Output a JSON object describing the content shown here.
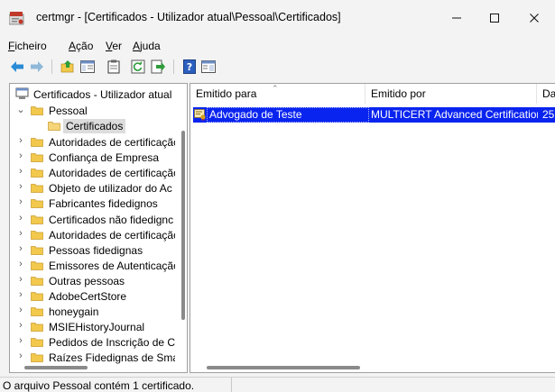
{
  "window": {
    "title": "certmgr - [Certificados - Utilizador atual\\Pessoal\\Certificados]"
  },
  "menu": [
    {
      "label": "Ficheiro",
      "ul": "F",
      "rest": "icheiro"
    },
    {
      "label": "Ação",
      "ul": "A",
      "rest": "ção"
    },
    {
      "label": "Ver",
      "ul": "V",
      "rest": "er"
    },
    {
      "label": "Ajuda",
      "ul": "A",
      "rest": "juda"
    }
  ],
  "tree": {
    "root": "Certificados - Utilizador atual",
    "pessoal": "Pessoal",
    "certificados": "Certificados",
    "items": [
      "Autoridades de certificação",
      "Confiança de Empresa",
      "Autoridades de certificação",
      "Objeto de utilizador do Ac",
      "Fabricantes fidedignos",
      "Certificados não fidedignc",
      "Autoridades de certificação",
      "Pessoas fidedignas",
      "Emissores de Autenticação",
      "Outras pessoas",
      "AdobeCertStore",
      "honeygain",
      "MSIEHistoryJournal",
      "Pedidos de Inscrição de Ce",
      "Raízes Fidedignas de Smar"
    ]
  },
  "list": {
    "columns": {
      "issued_to": "Emitido para",
      "issued_by": "Emitido por",
      "date": "Da"
    },
    "rows": [
      {
        "issued_to": "Advogado de Teste",
        "issued_by": "MULTICERT Advanced Certification ...",
        "date": "25"
      }
    ]
  },
  "status": {
    "text": "O arquivo Pessoal contém 1 certificado."
  },
  "colors": {
    "selection": "#0a24ef",
    "tree_selected": "#dcdcdc",
    "folder": "#f2c94c"
  }
}
